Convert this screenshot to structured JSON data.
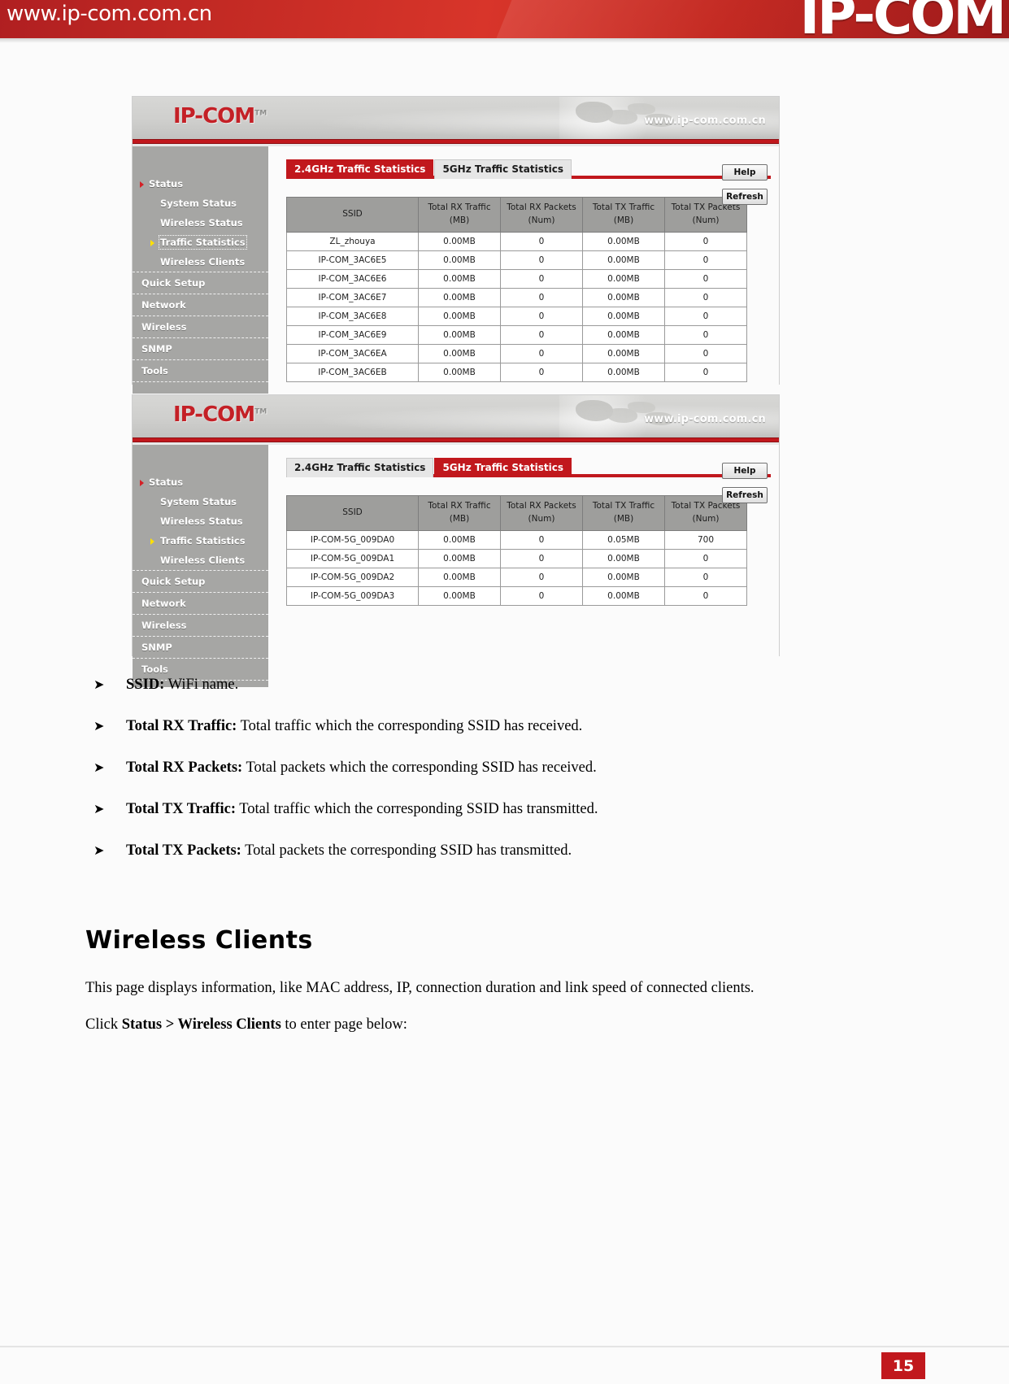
{
  "banner": {
    "url": "www.ip-com.com.cn",
    "logo": "IP-COM",
    "brand_red": "#c1181d"
  },
  "screenshots": [
    {
      "id": "shot-24",
      "head": {
        "logo": "IP-COM",
        "tm": "TM",
        "url": "www.ip-com.com.cn"
      },
      "sidebar": {
        "top": {
          "label": "Status"
        },
        "sub_items": [
          {
            "label": "System Status",
            "active": false
          },
          {
            "label": "Wireless Status",
            "active": false
          },
          {
            "label": "Traffic Statistics",
            "active": true
          },
          {
            "label": "Wireless Clients",
            "active": false
          }
        ],
        "sections": [
          {
            "label": "Quick Setup"
          },
          {
            "label": "Network"
          },
          {
            "label": "Wireless"
          },
          {
            "label": "SNMP"
          },
          {
            "label": "Tools"
          }
        ]
      },
      "tabs": [
        {
          "label": "2.4GHz Traffic Statistics",
          "active": true
        },
        {
          "label": "5GHz Traffic Statistics",
          "active": false
        }
      ],
      "buttons": [
        {
          "label": "Help"
        },
        {
          "label": "Refresh"
        }
      ],
      "table": {
        "headers": [
          {
            "line1": "SSID",
            "line2": ""
          },
          {
            "line1": "Total RX Traffic",
            "line2": "(MB)"
          },
          {
            "line1": "Total RX Packets",
            "line2": "(Num)"
          },
          {
            "line1": "Total TX Traffic",
            "line2": "(MB)"
          },
          {
            "line1": "Total TX Packets",
            "line2": "(Num)"
          }
        ],
        "rows": [
          [
            "ZL_zhouya",
            "0.00MB",
            "0",
            "0.00MB",
            "0"
          ],
          [
            "IP-COM_3AC6E5",
            "0.00MB",
            "0",
            "0.00MB",
            "0"
          ],
          [
            "IP-COM_3AC6E6",
            "0.00MB",
            "0",
            "0.00MB",
            "0"
          ],
          [
            "IP-COM_3AC6E7",
            "0.00MB",
            "0",
            "0.00MB",
            "0"
          ],
          [
            "IP-COM_3AC6E8",
            "0.00MB",
            "0",
            "0.00MB",
            "0"
          ],
          [
            "IP-COM_3AC6E9",
            "0.00MB",
            "0",
            "0.00MB",
            "0"
          ],
          [
            "IP-COM_3AC6EA",
            "0.00MB",
            "0",
            "0.00MB",
            "0"
          ],
          [
            "IP-COM_3AC6EB",
            "0.00MB",
            "0",
            "0.00MB",
            "0"
          ]
        ]
      }
    },
    {
      "id": "shot-5",
      "head": {
        "logo": "IP-COM",
        "tm": "TM",
        "url": "www.ip-com.com.cn"
      },
      "sidebar": {
        "top": {
          "label": "Status"
        },
        "sub_items": [
          {
            "label": "System Status",
            "active": false
          },
          {
            "label": "Wireless Status",
            "active": false
          },
          {
            "label": "Traffic Statistics",
            "active": true
          },
          {
            "label": "Wireless Clients",
            "active": false
          }
        ],
        "sections": [
          {
            "label": "Quick Setup"
          },
          {
            "label": "Network"
          },
          {
            "label": "Wireless"
          },
          {
            "label": "SNMP"
          },
          {
            "label": "Tools"
          }
        ]
      },
      "tabs": [
        {
          "label": "2.4GHz Traffic Statistics",
          "active": false
        },
        {
          "label": "5GHz Traffic Statistics",
          "active": true
        }
      ],
      "buttons": [
        {
          "label": "Help"
        },
        {
          "label": "Refresh"
        }
      ],
      "table": {
        "headers": [
          {
            "line1": "SSID",
            "line2": ""
          },
          {
            "line1": "Total RX Traffic",
            "line2": "(MB)"
          },
          {
            "line1": "Total RX Packets",
            "line2": "(Num)"
          },
          {
            "line1": "Total TX Traffic",
            "line2": "(MB)"
          },
          {
            "line1": "Total TX Packets",
            "line2": "(Num)"
          }
        ],
        "rows": [
          [
            "IP-COM-5G_009DA0",
            "0.00MB",
            "0",
            "0.05MB",
            "700"
          ],
          [
            "IP-COM-5G_009DA1",
            "0.00MB",
            "0",
            "0.00MB",
            "0"
          ],
          [
            "IP-COM-5G_009DA2",
            "0.00MB",
            "0",
            "0.00MB",
            "0"
          ],
          [
            "IP-COM-5G_009DA3",
            "0.00MB",
            "0",
            "0.00MB",
            "0"
          ]
        ]
      }
    }
  ],
  "doc": {
    "bullet_marker": "➤",
    "bullets": [
      {
        "term": "SSID:",
        "text": " WiFi name."
      },
      {
        "term": "Total RX Traffic:",
        "text": " Total traffic which the corresponding SSID has received."
      },
      {
        "term": "Total RX Packets:",
        "text": " Total packets which the corresponding SSID has received."
      },
      {
        "term": "Total TX Traffic:",
        "text": " Total traffic which the corresponding SSID has transmitted."
      },
      {
        "term": "Total TX Packets:",
        "text": " Total packets the corresponding SSID has transmitted."
      }
    ],
    "section_title": "Wireless Clients",
    "paragraph": "This page displays information, like MAC address, IP, connection duration and link speed of connected clients.",
    "click_prefix": "Click ",
    "click_path": "Status > Wireless Clients",
    "click_suffix": " to enter page below:"
  },
  "footer": {
    "page_number": "15"
  }
}
